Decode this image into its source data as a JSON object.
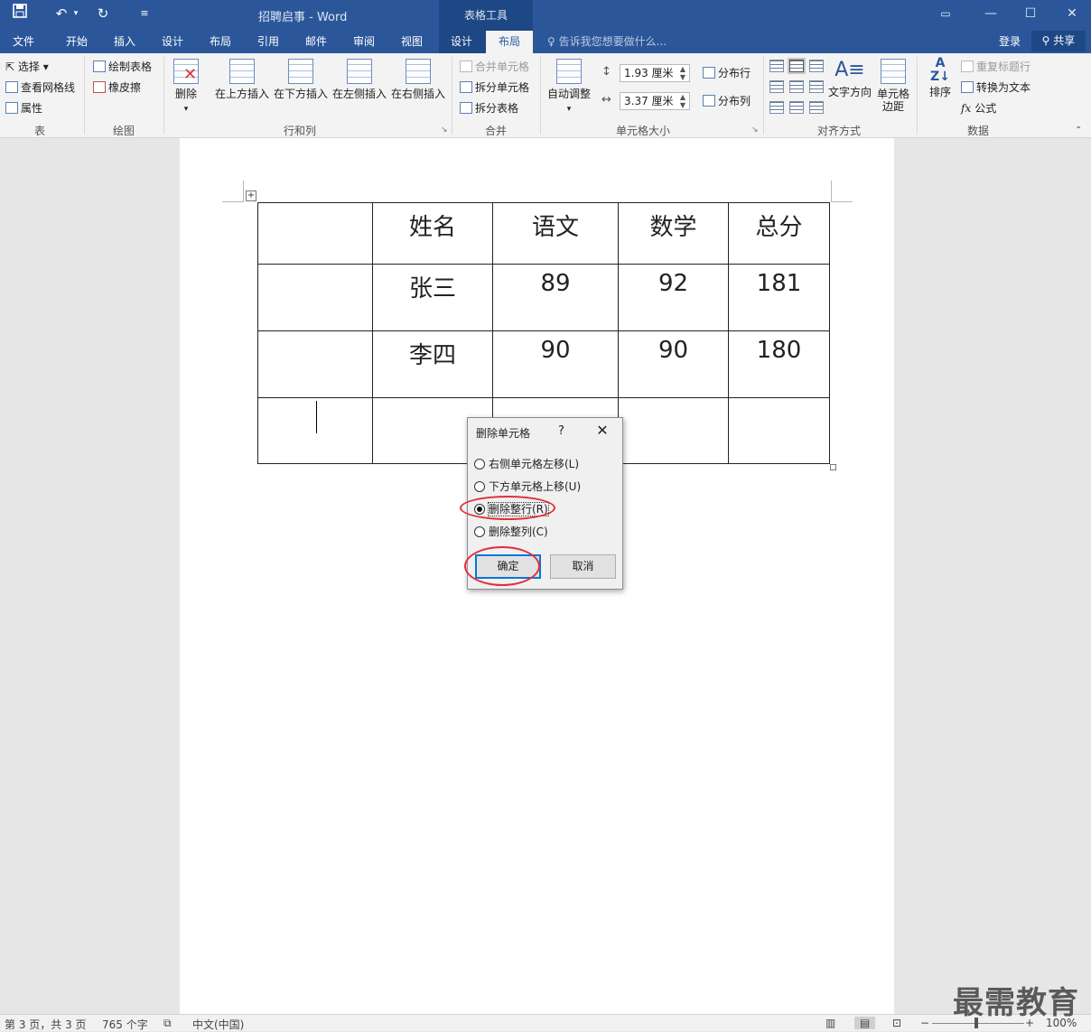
{
  "titlebar": {
    "doc_title": "招聘启事 - Word",
    "context_tools_title": "表格工具"
  },
  "tabs": {
    "items": [
      "文件",
      "开始",
      "插入",
      "设计",
      "布局",
      "引用",
      "邮件",
      "审阅",
      "视图"
    ],
    "context": [
      "设计",
      "布局"
    ],
    "active": "布局",
    "tell_me": "告诉我您想要做什么...",
    "login": "登录",
    "share": "共享"
  },
  "ribbon": {
    "table": {
      "select": "选择",
      "gridlines": "查看网格线",
      "properties": "属性",
      "label": "表"
    },
    "draw": {
      "draw_table": "绘制表格",
      "eraser": "橡皮擦",
      "label": "绘图"
    },
    "rows_cols": {
      "delete": "删除",
      "insert_above": "在上方插入",
      "insert_below": "在下方插入",
      "insert_left": "在左侧插入",
      "insert_right": "在右侧插入",
      "label": "行和列"
    },
    "merge": {
      "merge_cells": "合并单元格",
      "split_cells": "拆分单元格",
      "split_table": "拆分表格",
      "label": "合并"
    },
    "cell_size": {
      "autofit": "自动调整",
      "height": "1.93 厘米",
      "width": "3.37 厘米",
      "distribute_rows": "分布行",
      "distribute_cols": "分布列",
      "label": "单元格大小"
    },
    "alignment": {
      "text_direction": "文字方向",
      "cell_margins_1": "单元格",
      "cell_margins_2": "边距",
      "label": "对齐方式"
    },
    "data": {
      "sort": "排序",
      "repeat_header": "重复标题行",
      "convert_text": "转换为文本",
      "formula": "公式",
      "label": "数据"
    }
  },
  "table": {
    "rows": [
      [
        "",
        "姓名",
        "语文",
        "数学",
        "总分"
      ],
      [
        "",
        "张三",
        "89",
        "92",
        "181"
      ],
      [
        "",
        "李四",
        "90",
        "90",
        "180"
      ],
      [
        "",
        "",
        "",
        "",
        ""
      ]
    ]
  },
  "dialog": {
    "title": "删除单元格",
    "help": "?",
    "options": [
      "右侧单元格左移(L)",
      "下方单元格上移(U)",
      "删除整行(R)",
      "删除整列(C)"
    ],
    "selected_index": 2,
    "ok": "确定",
    "cancel": "取消"
  },
  "status": {
    "page": "第 3 页，共 3 页",
    "words": "765 个字",
    "language": "中文(中国)",
    "zoom": "100%"
  },
  "watermark": "最需教育"
}
